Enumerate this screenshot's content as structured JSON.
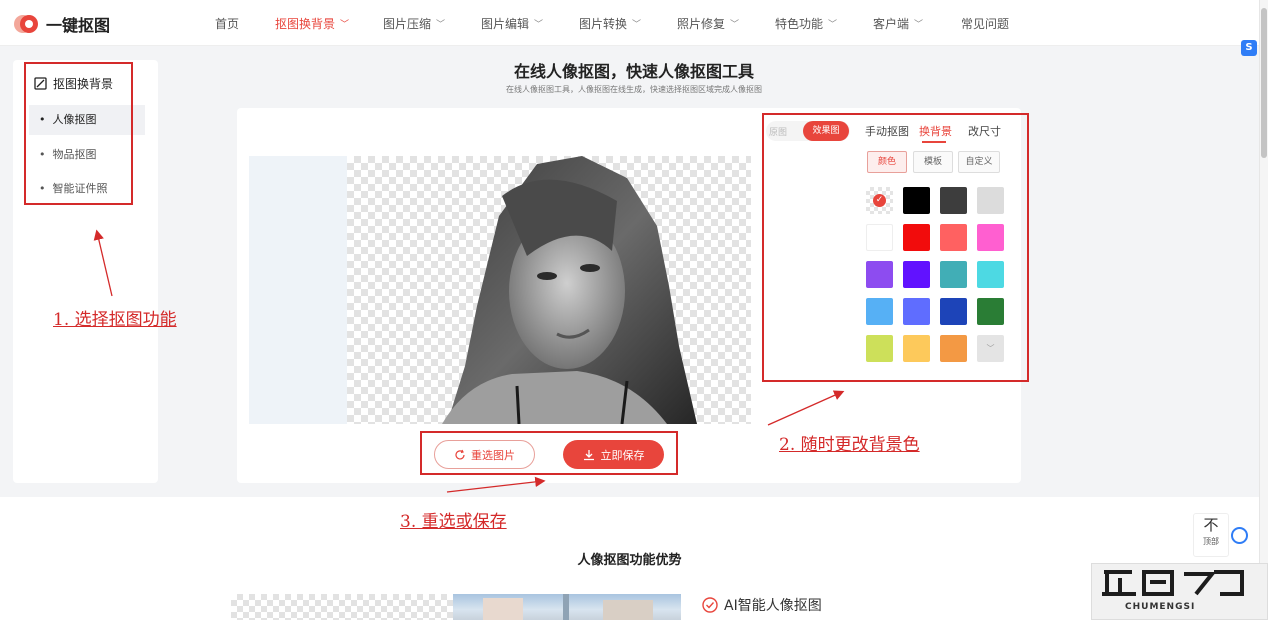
{
  "app": {
    "logo_text": "一键抠图"
  },
  "nav": {
    "items": [
      {
        "label": "首页",
        "has_dropdown": false,
        "active": false
      },
      {
        "label": "抠图换背景",
        "has_dropdown": true,
        "active": true
      },
      {
        "label": "图片压缩",
        "has_dropdown": true,
        "active": false
      },
      {
        "label": "图片编辑",
        "has_dropdown": true,
        "active": false
      },
      {
        "label": "图片转换",
        "has_dropdown": true,
        "active": false
      },
      {
        "label": "照片修复",
        "has_dropdown": true,
        "active": false
      },
      {
        "label": "特色功能",
        "has_dropdown": true,
        "active": false
      },
      {
        "label": "客户端",
        "has_dropdown": true,
        "active": false
      },
      {
        "label": "常见问题",
        "has_dropdown": false,
        "active": false
      }
    ]
  },
  "sidebar": {
    "title": "抠图换背景",
    "items": [
      {
        "label": "人像抠图",
        "active": true
      },
      {
        "label": "物品抠图",
        "active": false
      },
      {
        "label": "智能证件照",
        "active": false
      }
    ]
  },
  "hero": {
    "title": "在线人像抠图，快速人像抠图工具",
    "subtitle": "在线人像抠图工具，人像抠图在线生成，快速选择抠图区域完成人像抠图"
  },
  "editor": {
    "view_toggle": {
      "original": "原图",
      "result": "效果图",
      "selected": "效果图"
    },
    "tabs": [
      {
        "label": "手动抠图",
        "active": false
      },
      {
        "label": "换背景",
        "active": true
      },
      {
        "label": "改尺寸",
        "active": false
      }
    ],
    "bg_modes": [
      {
        "label": "颜色",
        "active": true
      },
      {
        "label": "模板",
        "active": false
      },
      {
        "label": "自定义",
        "active": false
      }
    ],
    "colors": [
      "transparent",
      "#000000",
      "#3d3d3d",
      "#dcdcdc",
      "#ffffff",
      "#f20c0c",
      "#ff6161",
      "#ff5fd0",
      "#8d4cf0",
      "#6112ff",
      "#41aeb6",
      "#4dd9e3",
      "#56b0f5",
      "#5f6dff",
      "#1d44b8",
      "#2a7d35",
      "#cde05a",
      "#fdc95b",
      "#f39944",
      "more"
    ],
    "selected_color": "transparent",
    "reselect_label": "重选图片",
    "save_label": "立即保存"
  },
  "annotations": {
    "step1": "1. 选择抠图功能",
    "step2": "2. 随时更改背景色",
    "step3": "3. 重选或保存"
  },
  "features": {
    "title": "人像抠图功能优势",
    "first_item": "AI智能人像抠图"
  },
  "floating": {
    "back_to_top": "顶部"
  },
  "watermark": {
    "text": "CHUMENGSI"
  },
  "colors": {
    "accent": "#e8453c",
    "annotation": "#d42a2a",
    "link_blue": "#2f7df6"
  }
}
